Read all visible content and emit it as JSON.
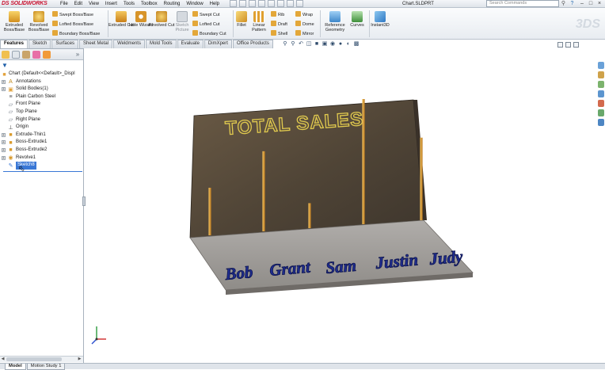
{
  "app": {
    "logo": "SOLIDWORKS",
    "document_title": "Chart.SLDPRT",
    "search_placeholder": "Search Commands"
  },
  "menu": [
    "File",
    "Edit",
    "View",
    "Insert",
    "Tools",
    "Toolbox",
    "Routing",
    "Window",
    "Help"
  ],
  "command_manager": {
    "extruded_boss": "Extruded Boss/Base",
    "revolved_boss": "Revolved Boss/Base",
    "swept_boss": "Swept Boss/Base",
    "lofted_boss": "Lofted Boss/Base",
    "boundary_boss": "Boundary Boss/Base",
    "extruded_cut": "Extruded Cut",
    "hole_wizard": "Hole Wizard",
    "revolved_cut": "Revolved Cut",
    "sketch_picture": "Sketch Picture",
    "swept_cut": "Swept Cut",
    "lofted_cut": "Lofted Cut",
    "boundary_cut": "Boundary Cut",
    "fillet": "Fillet",
    "linear_pattern": "Linear Pattern",
    "rib": "Rib",
    "draft": "Draft",
    "shell": "Shell",
    "wrap": "Wrap",
    "dome": "Dome",
    "mirror": "Mirror",
    "reference_geometry": "Reference Geometry",
    "curves": "Curves",
    "instant3d": "Instant3D"
  },
  "tabs": [
    "Features",
    "Sketch",
    "Surfaces",
    "Sheet Metal",
    "Weldments",
    "Mold Tools",
    "Evaluate",
    "DimXpert",
    "Office Products"
  ],
  "active_tab": "Features",
  "tree": {
    "root": "Chart  (Default<<Default>_Displ",
    "items": [
      {
        "label": "Annotations",
        "icon": "annotations-icon"
      },
      {
        "label": "Solid Bodies(1)",
        "icon": "solid-bodies-icon"
      },
      {
        "label": "Plain Carbon Steel",
        "icon": "material-icon"
      },
      {
        "label": "Front Plane",
        "icon": "plane-icon"
      },
      {
        "label": "Top Plane",
        "icon": "plane-icon"
      },
      {
        "label": "Right Plane",
        "icon": "plane-icon"
      },
      {
        "label": "Origin",
        "icon": "origin-icon"
      },
      {
        "label": "Extrude-Thin1",
        "icon": "extrude-icon"
      },
      {
        "label": "Boss-Extrude1",
        "icon": "extrude-icon"
      },
      {
        "label": "Boss-Extrude2",
        "icon": "extrude-icon"
      },
      {
        "label": "Revolve1",
        "icon": "revolve-icon"
      },
      {
        "label": "Sketch8",
        "icon": "sketch-icon"
      }
    ]
  },
  "model": {
    "title_text": "TOTAL SALES",
    "names": [
      "Bob",
      "Grant",
      "Sam",
      "Justin",
      "Judy"
    ],
    "bar_levels": [
      0.38,
      0.64,
      0.2,
      1.0,
      0.66
    ],
    "colors": {
      "wall": "#56493a",
      "base": "#9b9895",
      "bar": "#e2a23a",
      "letters": "#1f2d8f",
      "title": "#d9c34a"
    }
  },
  "bottom_tabs": [
    "Model",
    "Motion Study 1"
  ],
  "active_bottom_tab": "Model"
}
